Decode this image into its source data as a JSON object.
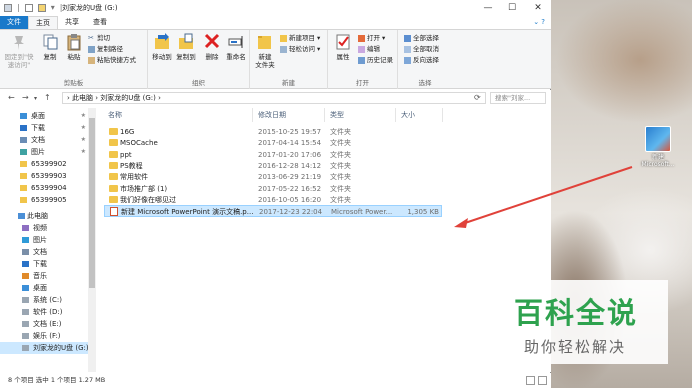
{
  "window": {
    "title": "刘家龙的U盘 (G:)",
    "controls": [
      "—",
      "☐",
      "✕"
    ]
  },
  "tabs": {
    "file": "文件",
    "home": "主页",
    "share": "共享",
    "view": "查看"
  },
  "ribbon": {
    "clipboard": {
      "pin": "固定到\"快\n速访问\"",
      "copy": "复制",
      "paste": "粘贴",
      "cut": "剪切",
      "copy_path": "复制路径",
      "paste_shortcut": "粘贴快捷方式",
      "label": "剪贴板"
    },
    "organize": {
      "move_to": "移动到",
      "copy_to": "复制到",
      "delete": "删除",
      "rename": "重命名",
      "label": "组织"
    },
    "new": {
      "new_folder": "新建\n文件夹",
      "new_item": "新建项目",
      "easy_access": "轻松访问",
      "label": "新建"
    },
    "open": {
      "properties": "属性",
      "open": "打开",
      "edit": "编辑",
      "history": "历史记录",
      "label": "打开"
    },
    "select": {
      "select_all": "全部选择",
      "select_none": "全部取消",
      "invert": "反向选择",
      "label": "选择"
    }
  },
  "address": {
    "back": "←",
    "forward": "→",
    "up": "↑",
    "path": "› 此电脑 › 刘家龙的U盘 (G:) ›",
    "search_placeholder": "搜索\"刘家...",
    "refresh": "⟳"
  },
  "navpane": {
    "quick": [
      {
        "label": "桌面",
        "pinned": true
      },
      {
        "label": "下载",
        "pinned": true
      },
      {
        "label": "文档",
        "pinned": true
      },
      {
        "label": "图片",
        "pinned": true
      },
      {
        "label": "65399902",
        "pinned": false
      },
      {
        "label": "65399903",
        "pinned": false
      },
      {
        "label": "65399904",
        "pinned": false
      },
      {
        "label": "65399905",
        "pinned": false
      }
    ],
    "this_pc": "此电脑",
    "pc_items": [
      "视频",
      "图片",
      "文档",
      "下载",
      "音乐",
      "桌面",
      "系统 (C:)",
      "软件 (D:)",
      "文档 (E:)",
      "娱乐 (F:)",
      "刘家龙的U盘 (G:)"
    ]
  },
  "filelist": {
    "columns": [
      "名称",
      "修改日期",
      "类型",
      "大小"
    ],
    "rows": [
      {
        "name": "16G",
        "date": "2015-10-25 19:57",
        "type": "文件夹",
        "size": "",
        "kind": "folder"
      },
      {
        "name": "MSOCache",
        "date": "2017-04-14 15:54",
        "type": "文件夹",
        "size": "",
        "kind": "folder"
      },
      {
        "name": "ppt",
        "date": "2017-01-20 17:06",
        "type": "文件夹",
        "size": "",
        "kind": "folder"
      },
      {
        "name": "PS教程",
        "date": "2016-12-28 14:12",
        "type": "文件夹",
        "size": "",
        "kind": "folder"
      },
      {
        "name": "常用软件",
        "date": "2013-06-29 21:19",
        "type": "文件夹",
        "size": "",
        "kind": "folder"
      },
      {
        "name": "市场推广部 (1)",
        "date": "2017-05-22 16:52",
        "type": "文件夹",
        "size": "",
        "kind": "folder"
      },
      {
        "name": "我们好像在哪见过",
        "date": "2016-10-05 16:20",
        "type": "文件夹",
        "size": "",
        "kind": "folder"
      },
      {
        "name": "新建 Microsoft PowerPoint 演示文稿.p...",
        "date": "2017-12-23 22:04",
        "type": "Microsoft Power...",
        "size": "1,305 KB",
        "kind": "ppt"
      }
    ]
  },
  "status": {
    "text": "8 个项目   选中 1 个项目  1.27 MB"
  },
  "desktop": {
    "icon_label": "新建\nMicrosoft..."
  },
  "watermark": {
    "big": "百科全说",
    "small": "助你轻松解决"
  },
  "colors": {
    "accent": "#1979ca",
    "selection": "#cce8ff",
    "folder": "#f1c54a",
    "arrow": "#e0423a",
    "watermark_green": "#2ea24e"
  }
}
